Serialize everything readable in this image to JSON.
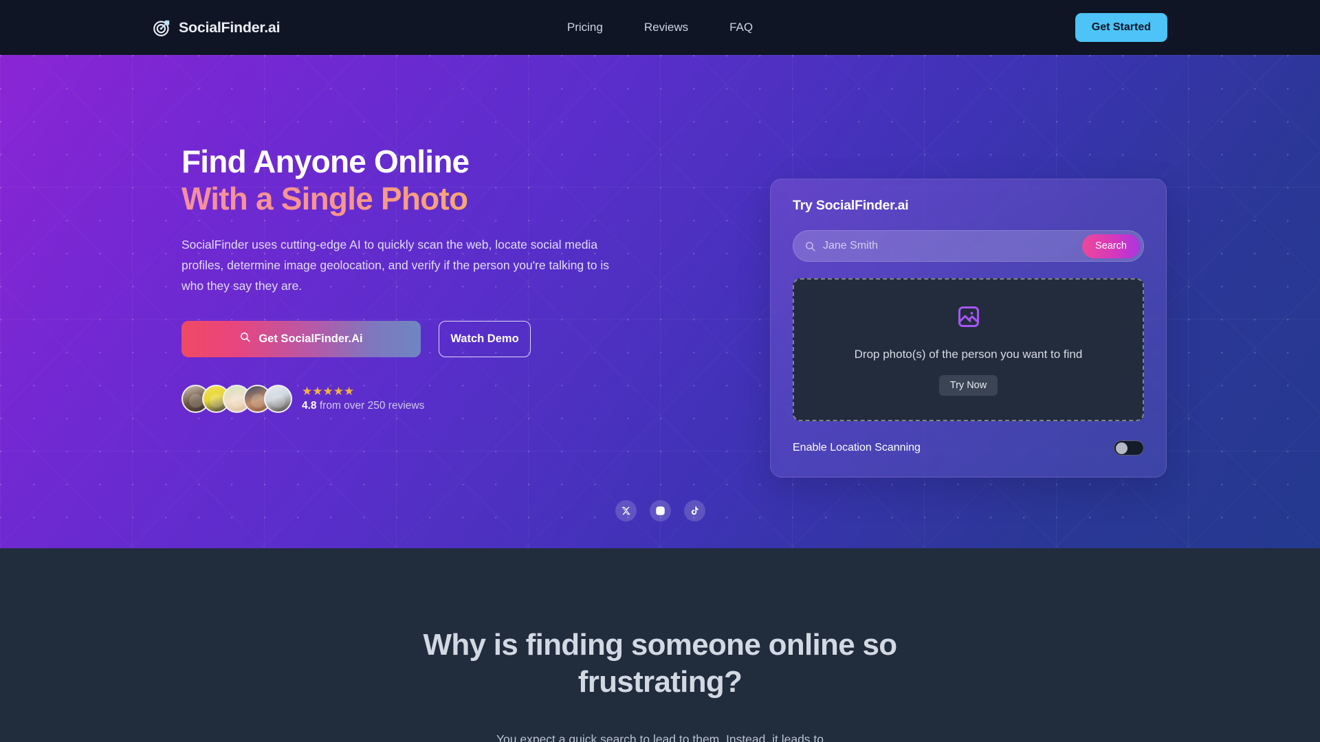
{
  "nav": {
    "logo_icon": "target-dart-icon",
    "logo_text": "SocialFinder.ai",
    "links": [
      {
        "label": "Pricing"
      },
      {
        "label": "Reviews"
      },
      {
        "label": "FAQ"
      }
    ],
    "cta_label": "Get Started",
    "cta_color": "#4dc3f7",
    "background": "#0f1524"
  },
  "hero": {
    "heading_line1": "Find Anyone Online",
    "heading_line2": "With a Single Photo",
    "heading_gradient_from": "#f48fa0",
    "heading_gradient_to": "#fbc06b",
    "subtitle": "SocialFinder uses cutting-edge AI to quickly scan the web, locate social media profiles, determine image geolocation, and verify if the person you're talking to is who they say they are.",
    "primary_button": {
      "label": "Get SocialFinder.Ai",
      "icon": "search-icon",
      "gradient_from": "#ef4a63",
      "gradient_to": "#6f86c2"
    },
    "secondary_button": {
      "label": "Watch Demo"
    },
    "rating": {
      "stars": "★★★★★",
      "star_count": 5,
      "star_color": "#f6b33c",
      "score": "4.8",
      "text": " from over 250 reviews",
      "avatar_count": 5
    },
    "background_from": "#8b25d4",
    "background_to": "#24398f"
  },
  "try_card": {
    "title": "Try SocialFinder.ai",
    "search": {
      "icon": "search-icon",
      "value": "",
      "placeholder": "Jane Smith",
      "button_label": "Search",
      "button_gradient_from": "#ec4899",
      "button_gradient_to": "#a935e0"
    },
    "dropzone": {
      "icon": "image-icon",
      "icon_color": "#a855f7",
      "text": "Drop photo(s) of the person you want to find",
      "button_label": "Try Now"
    },
    "toggle": {
      "label": "Enable Location Scanning",
      "state": "off"
    }
  },
  "social": {
    "items": [
      {
        "name": "x-twitter-icon"
      },
      {
        "name": "instagram-icon"
      },
      {
        "name": "tiktok-icon"
      }
    ]
  },
  "section2": {
    "title": "Why is finding someone online so frustrating?",
    "subtitle": "You expect a quick search to lead to them. Instead, it leads to",
    "background": "#212c3d"
  }
}
